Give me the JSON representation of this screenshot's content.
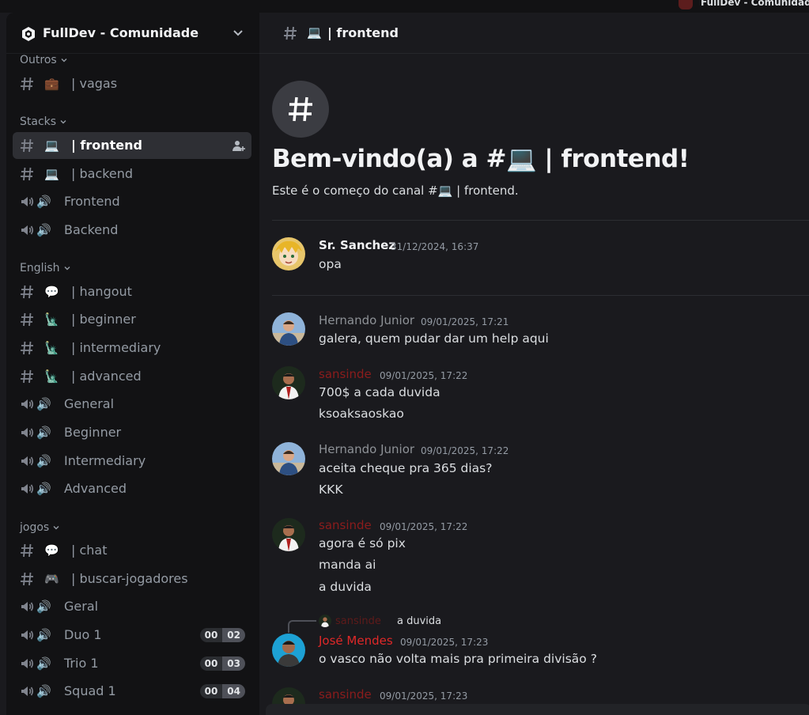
{
  "window": {
    "title": "FullDev - Comunidade"
  },
  "server": {
    "name": "FullDev - Comunidade"
  },
  "categories": {
    "outros": "Outros",
    "stacks": "Stacks",
    "english": "English",
    "jogos": "jogos"
  },
  "channels": [
    {
      "type": "text",
      "emoji": "💼",
      "label": "| vagas"
    },
    {
      "type": "text",
      "emoji": "💻",
      "label": "| frontend",
      "active": true
    },
    {
      "type": "text",
      "emoji": "💻",
      "label": "| backend"
    },
    {
      "type": "voice",
      "label": "Frontend"
    },
    {
      "type": "voice",
      "label": "Backend"
    },
    {
      "type": "text",
      "emoji": "💬",
      "label": "| hangout"
    },
    {
      "type": "text",
      "emoji": "🗽",
      "label": "| beginner"
    },
    {
      "type": "text",
      "emoji": "🗽",
      "label": "| intermediary"
    },
    {
      "type": "text",
      "emoji": "🗽",
      "label": "| advanced"
    },
    {
      "type": "voice",
      "label": "General"
    },
    {
      "type": "voice",
      "label": "Beginner"
    },
    {
      "type": "voice",
      "label": "Intermediary"
    },
    {
      "type": "voice",
      "label": "Advanced"
    },
    {
      "type": "text",
      "emoji": "💬",
      "label": "| chat"
    },
    {
      "type": "text",
      "emoji": "🎮",
      "label": "| buscar-jogadores"
    },
    {
      "type": "voice",
      "label": "Geral"
    },
    {
      "type": "voice",
      "label": "Duo 1",
      "count": "00",
      "limit": "02"
    },
    {
      "type": "voice",
      "label": "Trio 1",
      "count": "00",
      "limit": "03"
    },
    {
      "type": "voice",
      "label": "Squad 1",
      "count": "00",
      "limit": "04"
    }
  ],
  "header": {
    "emoji": "💻",
    "label": "| frontend"
  },
  "welcome": {
    "title_prefix": "Bem-vindo(a) a #",
    "emoji": "💻",
    "title_suffix": " | frontend!",
    "sub_prefix": "Este é o começo do canal #",
    "sub_emoji": "💻",
    "sub_suffix": " | frontend."
  },
  "messages": [
    {
      "author": "Sr. Sanchez",
      "time": "31/12/2024, 16:37",
      "lines": [
        "opa"
      ]
    },
    {
      "author": "Hernando Junior",
      "time": "09/01/2025, 17:21",
      "lines": [
        "galera, quem pudar dar um help aqui"
      ]
    },
    {
      "author": "sansinde",
      "time": "09/01/2025, 17:22",
      "lines": [
        "700$ a cada duvida",
        "ksoaksaoskao"
      ]
    },
    {
      "author": "Hernando Junior",
      "time": "09/01/2025, 17:22",
      "lines": [
        "aceita cheque pra 365 dias?",
        "KKK"
      ]
    },
    {
      "author": "sansinde",
      "time": "09/01/2025, 17:22",
      "lines": [
        "agora é só pix",
        "manda ai",
        "a duvida"
      ]
    },
    {
      "author": "José Mendes",
      "time": "09/01/2025, 17:23",
      "lines": [
        "o vasco não volta mais pra primeira divisão ?"
      ],
      "reply_to": {
        "author": "sansinde",
        "text": "a duvida"
      }
    },
    {
      "author": "sansinde",
      "time": "09/01/2025, 17:23",
      "lines": []
    }
  ],
  "colors": {
    "sidebar_bg": "#121214",
    "main_bg": "#1a1a1e",
    "active_channel": "#2e2f34",
    "name_red": "#e02828"
  },
  "icons": {
    "server": "server-logo-icon",
    "chevron": "chevron-down-icon",
    "text_channel": "hash-icon",
    "voice_channel": "speaker-icon",
    "invite": "add-member-icon"
  }
}
